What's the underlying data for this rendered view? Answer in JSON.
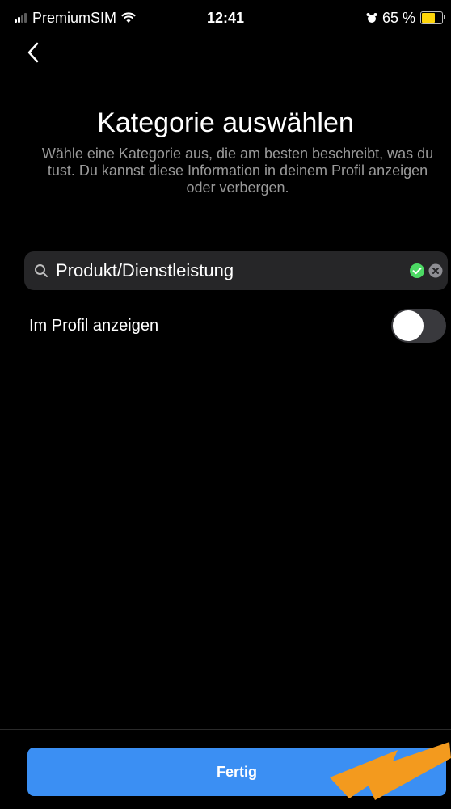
{
  "status_bar": {
    "carrier": "PremiumSIM",
    "time": "12:41",
    "battery": "65 %",
    "battery_level": 0.65
  },
  "header": {
    "title": "Kategorie auswählen",
    "subtitle": "Wähle eine Kategorie aus, die am besten beschreibt, was du tust. Du kannst diese Information in deinem Profil anzeigen oder verbergen."
  },
  "search": {
    "value": "Produkt/Dienstleistung"
  },
  "toggle": {
    "label": "Im Profil anzeigen",
    "on": false
  },
  "footer": {
    "done_label": "Fertig"
  },
  "colors": {
    "background": "#000000",
    "accent": "#3b8ff3",
    "success": "#4cd964",
    "annotation_arrow": "#f39a1e"
  },
  "icons": [
    "back-icon",
    "search-icon",
    "check-icon",
    "clear-icon",
    "wifi-icon",
    "alarm-icon",
    "battery-icon"
  ]
}
